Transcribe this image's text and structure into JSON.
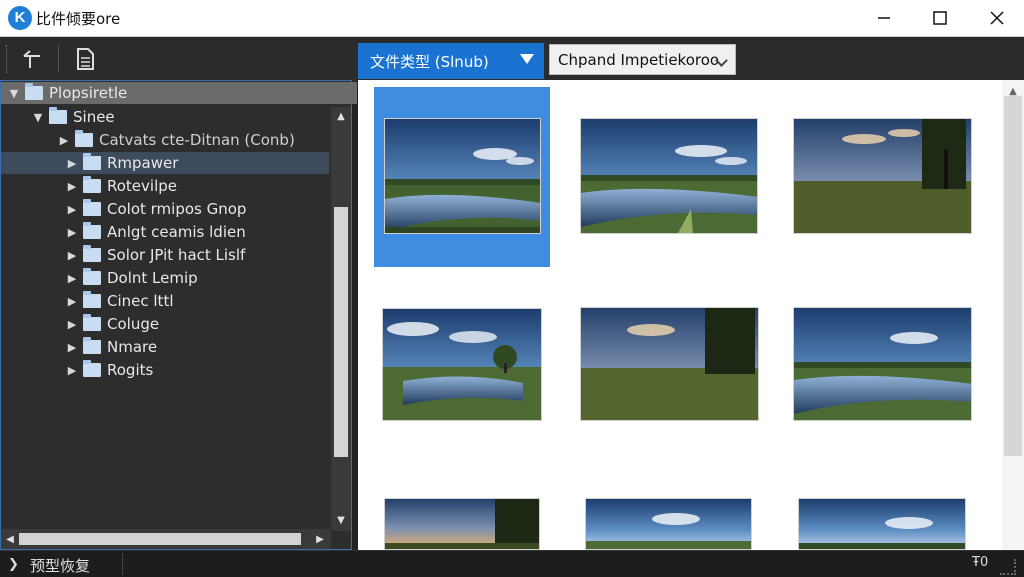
{
  "window": {
    "title": "比件倾要ore",
    "app_icon": "K",
    "minimize_icon": "minimize-icon",
    "maximize_icon": "maximize-icon",
    "close_icon": "close-icon"
  },
  "toolbar": {
    "back_icon": "back-arrow-icon",
    "document_icon": "document-icon"
  },
  "tree": {
    "root": {
      "label": "Plopsiretle",
      "expanded": true
    },
    "items": [
      {
        "label": "Sinee",
        "level": 1,
        "expanded": true
      },
      {
        "label": "Catvats cte-Ditnan (Conb)",
        "level": 2,
        "expanded": false
      },
      {
        "label": "Rmpawer",
        "level": 3,
        "selected": true
      },
      {
        "label": "Rotevilpe",
        "level": 3
      },
      {
        "label": "Colot rmipos Gnop",
        "level": 3
      },
      {
        "label": "Anlgt ceamis ldien",
        "level": 3
      },
      {
        "label": "Solor JPit hact Lislf",
        "level": 3
      },
      {
        "label": "Dolnt Lemip",
        "level": 3
      },
      {
        "label": "Cinec lttl",
        "level": 3
      },
      {
        "label": "Coluge",
        "level": 3
      },
      {
        "label": "Nmare",
        "level": 3
      },
      {
        "label": "Rogits",
        "level": 3
      }
    ]
  },
  "filter": {
    "type_label": "文件类型 (Slnub)",
    "sort_label": "Chpand Impetiekoroo"
  },
  "thumbnails": [
    {
      "name": "photo-1",
      "scene": "river-clouds",
      "selected": true
    },
    {
      "name": "photo-2",
      "scene": "river-clouds"
    },
    {
      "name": "photo-3",
      "scene": "sunset-field"
    },
    {
      "name": "photo-4",
      "scene": "pond-tree"
    },
    {
      "name": "photo-5",
      "scene": "sunset-field"
    },
    {
      "name": "photo-6",
      "scene": "river-clouds"
    },
    {
      "name": "photo-7",
      "scene": "sunset-field"
    },
    {
      "name": "photo-8",
      "scene": "pond-tree"
    },
    {
      "name": "photo-9",
      "scene": "river-clouds"
    }
  ],
  "status": {
    "text": "预型恢复",
    "left_icon": "expand-icon",
    "right_text": "Ŧ0"
  },
  "colors": {
    "accent": "#1a73d0",
    "selection": "#3f8de0",
    "panel": "#2d2d2d"
  }
}
